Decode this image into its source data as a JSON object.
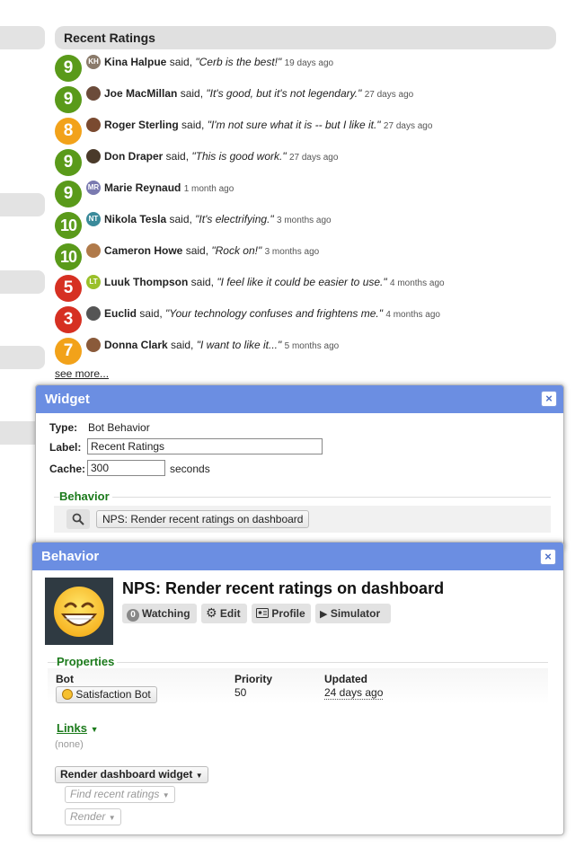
{
  "ratings": {
    "title": "Recent Ratings",
    "items": [
      {
        "score": "9",
        "color": "#5a9a1a",
        "initials": "KH",
        "avatar_color": "#8a7a6a",
        "name": "Kina Halpue",
        "said": " said, ",
        "quote": "\"Cerb is the best!\"",
        "ago": "19 days ago"
      },
      {
        "score": "9",
        "color": "#5a9a1a",
        "initials": "",
        "avatar_color": "#6b4b3a",
        "name": "Joe MacMillan",
        "said": " said, ",
        "quote": "\"It's good, but it's not legendary.\"",
        "ago": "27 days ago"
      },
      {
        "score": "8",
        "color": "#f2a21a",
        "initials": "",
        "avatar_color": "#7a4a30",
        "name": "Roger Sterling",
        "said": " said, ",
        "quote": "\"I'm not sure what it is -- but I like it.\"",
        "ago": "27 days ago"
      },
      {
        "score": "9",
        "color": "#5a9a1a",
        "initials": "",
        "avatar_color": "#4a3a2a",
        "name": "Don Draper",
        "said": " said, ",
        "quote": "\"This is good work.\"",
        "ago": "27 days ago"
      },
      {
        "score": "9",
        "color": "#5a9a1a",
        "initials": "MR",
        "avatar_color": "#7a7ab0",
        "name": "Marie Reynaud",
        "said": "",
        "quote": "",
        "ago": "1 month ago"
      },
      {
        "score": "10",
        "color": "#5a9a1a",
        "initials": "NT",
        "avatar_color": "#3a8a9a",
        "name": "Nikola Tesla",
        "said": " said, ",
        "quote": "\"It's electrifying.\"",
        "ago": "3 months ago"
      },
      {
        "score": "10",
        "color": "#5a9a1a",
        "initials": "",
        "avatar_color": "#b07a4a",
        "name": "Cameron Howe",
        "said": " said, ",
        "quote": "\"Rock on!\"",
        "ago": "3 months ago"
      },
      {
        "score": "5",
        "color": "#d63022",
        "initials": "LT",
        "avatar_color": "#9ac02a",
        "name": "Luuk Thompson",
        "said": " said, ",
        "quote": "\"I feel like it could be easier to use.\"",
        "ago": "4 months ago"
      },
      {
        "score": "3",
        "color": "#d63022",
        "initials": "",
        "avatar_color": "#555555",
        "name": "Euclid",
        "said": " said, ",
        "quote": "\"Your technology confuses and frightens me.\"",
        "ago": "4 months ago"
      },
      {
        "score": "7",
        "color": "#f2a21a",
        "initials": "",
        "avatar_color": "#8a5a3a",
        "name": "Donna Clark",
        "said": " said, ",
        "quote": "\"I want to like it...\"",
        "ago": "5 months ago"
      }
    ],
    "see_more": "see more..."
  },
  "widget": {
    "title": "Widget",
    "close": "×",
    "type_label": "Type:",
    "type_value": "Bot Behavior",
    "label_label": "Label:",
    "label_value": "Recent Ratings",
    "cache_label": "Cache:",
    "cache_value": "300",
    "cache_unit": "seconds",
    "behavior_section": "Behavior",
    "behavior_chip": "NPS: Render recent ratings on dashboard"
  },
  "behavior": {
    "title": "Behavior",
    "close": "×",
    "heading": "NPS: Render recent ratings on dashboard",
    "watching_count": "0",
    "watching_label": "Watching",
    "edit_label": "Edit",
    "profile_label": "Profile",
    "simulator_label": "Simulator",
    "properties_title": "Properties",
    "bot_header": "Bot",
    "bot_value": "Satisfaction Bot",
    "priority_header": "Priority",
    "priority_value": "50",
    "updated_header": "Updated",
    "updated_value": "24 days ago",
    "links_label": "Links",
    "links_none": "(none)",
    "render_widget_label": "Render dashboard widget",
    "find_ratings_label": "Find recent ratings",
    "render_label": "Render"
  }
}
